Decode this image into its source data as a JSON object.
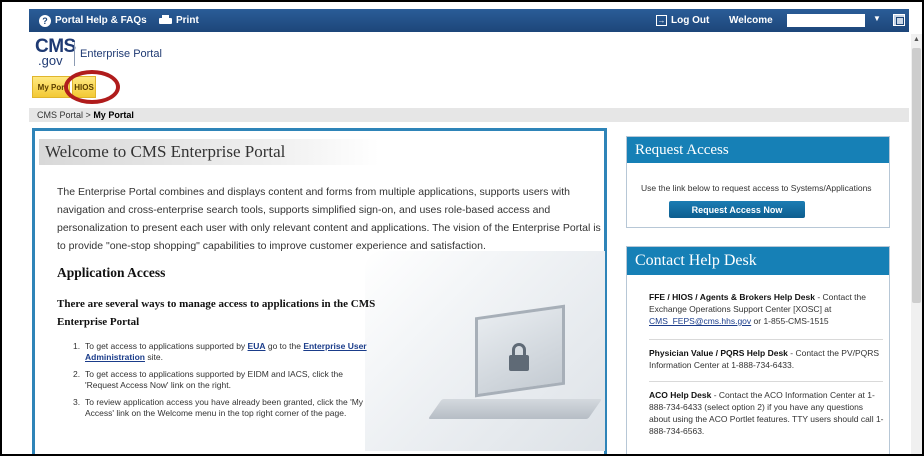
{
  "topbar": {
    "help_label": "Portal Help & FAQs",
    "print_label": "Print",
    "logout_label": "Log Out",
    "welcome_label": "Welcome"
  },
  "logo": {
    "cms": "CMS",
    "gov": ".gov",
    "text": "Enterprise Portal"
  },
  "tabs": {
    "my_portal": "My Por",
    "hios": "HIOS"
  },
  "breadcrumb": {
    "root": "CMS Portal",
    "separator": ">",
    "current": "My Portal"
  },
  "main": {
    "title": "Welcome to CMS Enterprise Portal",
    "intro": "The Enterprise Portal combines and displays content and forms from multiple applications, supports users with navigation and cross-enterprise search tools, supports simplified sign-on, and uses role-based access and personalization to present each user with only relevant content and applications. The vision of the Enterprise Portal is to provide \"one-stop shopping\" capabilities to improve customer experience and satisfaction.",
    "app_access_title": "Application Access",
    "ways_title": "There are several ways to manage access to applications in the CMS Enterprise Portal",
    "steps": [
      {
        "num": "1.",
        "pre": "To get access to applications supported by ",
        "link1": "EUA",
        "mid": " go to the ",
        "link2": "Enterprise User Administration",
        "post": " site."
      },
      {
        "num": "2.",
        "text": "To get access to applications supported by EIDM and IACS, click the 'Request Access Now' link on the right."
      },
      {
        "num": "3.",
        "text": "To review application access you have already been granted, click the 'My Access' link on the Welcome menu in the top right corner of the page."
      }
    ]
  },
  "request_access": {
    "title": "Request Access",
    "text": "Use the link below to request access to Systems/Applications",
    "button": "Request Access Now"
  },
  "help_desk": {
    "title": "Contact Help Desk",
    "entries": [
      {
        "name": "FFE / HIOS / Agents & Brokers Help Desk",
        "pre": " - Contact the Exchange Operations Support Center [XOSC] at ",
        "email": "CMS_FEPS@cms.hhs.gov",
        "post": " or 1-855-CMS-1515"
      },
      {
        "name": "Physician Value / PQRS Help Desk",
        "pre": " - Contact the PV/PQRS Information Center at 1-888-734-6433."
      },
      {
        "name": "ACO Help Desk",
        "pre": " - Contact the ACO Information Center at 1-888-734-6433 (select option 2) if you have any questions about using the ACO Portlet features. TTY users should call 1-888-734-6563."
      }
    ]
  },
  "colors": {
    "topbar": "#1d4679",
    "accent": "#1680b6",
    "tab": "#f3c935",
    "highlight": "#b01c1c"
  }
}
